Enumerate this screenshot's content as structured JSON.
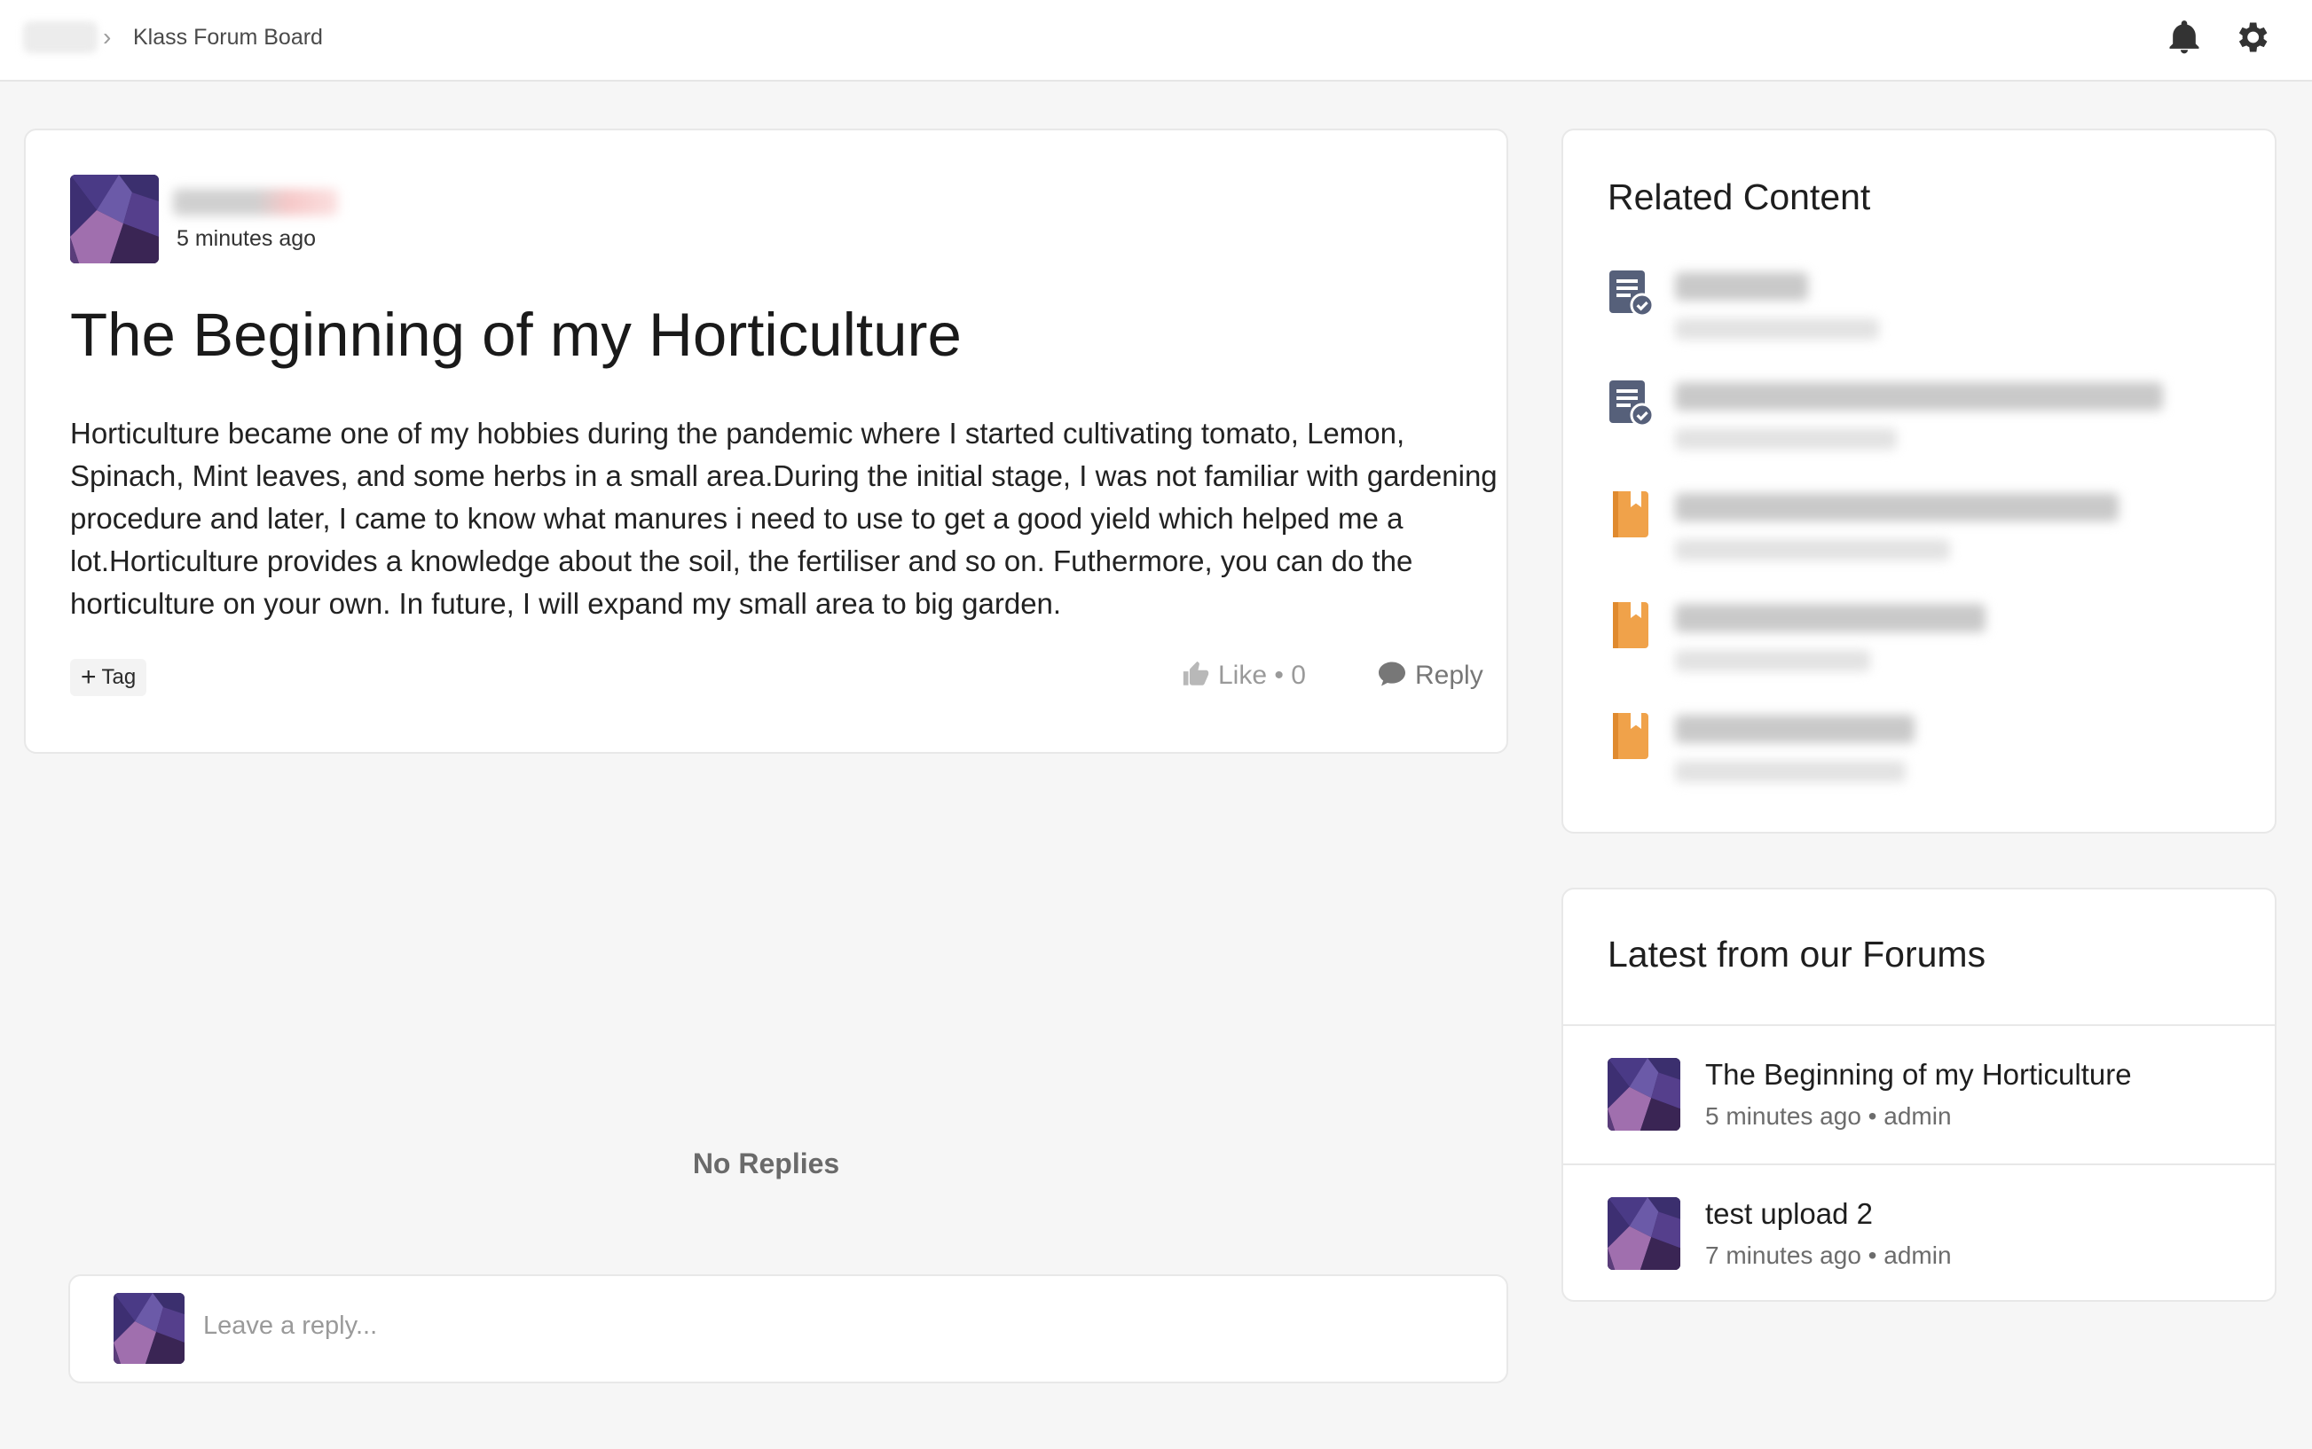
{
  "breadcrumb": {
    "current": "Klass Forum Board"
  },
  "icons": {
    "notifications": "bell-icon",
    "settings": "gear-icon"
  },
  "post": {
    "time": "5 minutes ago",
    "title": "The Beginning of my Horticulture",
    "body": "Horticulture became one of my hobbies during the pandemic where I started cultivating tomato, Lemon, Spinach, Mint leaves, and some herbs in a small area.During the initial stage, I was not familiar with gardening procedure and later, I came to know what manures i need to use to get a good yield which helped me a lot.Horticulture provides a knowledge about the soil, the fertiliser and so on. Futhermore, you can do the horticulture on your own. In future, I will expand my small area to big garden.",
    "tag_label": "Tag",
    "like_label": "Like • 0",
    "reply_label": "Reply"
  },
  "replies": {
    "empty_text": "No Replies",
    "input_placeholder": "Leave a reply..."
  },
  "related": {
    "title": "Related Content",
    "items": [
      {
        "icon": "document-check-icon",
        "color": "#56607a"
      },
      {
        "icon": "document-check-icon",
        "color": "#56607a"
      },
      {
        "icon": "bookmark-book-icon",
        "color": "#f0a24a"
      },
      {
        "icon": "bookmark-book-icon",
        "color": "#f0a24a"
      },
      {
        "icon": "bookmark-book-icon",
        "color": "#f0a24a"
      }
    ]
  },
  "forums": {
    "title": "Latest from our Forums",
    "items": [
      {
        "title": "The Beginning of my Horticulture",
        "meta": "5 minutes ago • admin"
      },
      {
        "title": "test upload 2",
        "meta": "7 minutes ago • admin"
      }
    ]
  }
}
